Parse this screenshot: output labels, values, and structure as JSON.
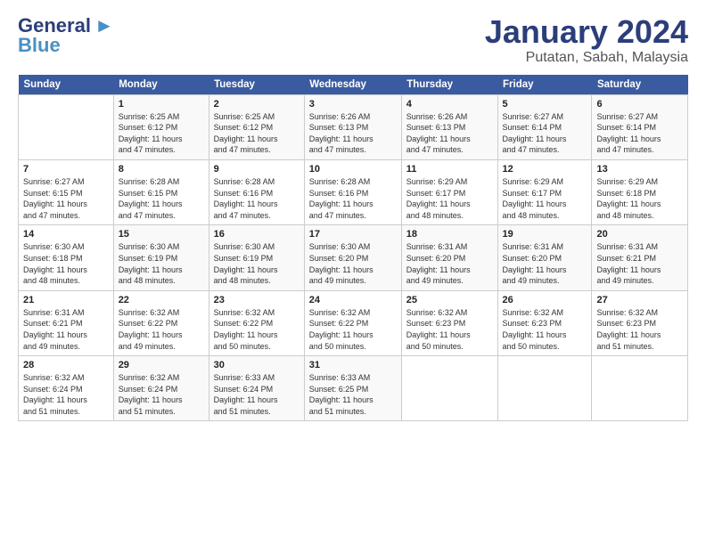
{
  "logo": {
    "line1": "General",
    "line2": "Blue"
  },
  "title": "January 2024",
  "subtitle": "Putatan, Sabah, Malaysia",
  "days_header": [
    "Sunday",
    "Monday",
    "Tuesday",
    "Wednesday",
    "Thursday",
    "Friday",
    "Saturday"
  ],
  "weeks": [
    [
      {
        "num": "",
        "info": ""
      },
      {
        "num": "1",
        "info": "Sunrise: 6:25 AM\nSunset: 6:12 PM\nDaylight: 11 hours\nand 47 minutes."
      },
      {
        "num": "2",
        "info": "Sunrise: 6:25 AM\nSunset: 6:12 PM\nDaylight: 11 hours\nand 47 minutes."
      },
      {
        "num": "3",
        "info": "Sunrise: 6:26 AM\nSunset: 6:13 PM\nDaylight: 11 hours\nand 47 minutes."
      },
      {
        "num": "4",
        "info": "Sunrise: 6:26 AM\nSunset: 6:13 PM\nDaylight: 11 hours\nand 47 minutes."
      },
      {
        "num": "5",
        "info": "Sunrise: 6:27 AM\nSunset: 6:14 PM\nDaylight: 11 hours\nand 47 minutes."
      },
      {
        "num": "6",
        "info": "Sunrise: 6:27 AM\nSunset: 6:14 PM\nDaylight: 11 hours\nand 47 minutes."
      }
    ],
    [
      {
        "num": "7",
        "info": "Sunrise: 6:27 AM\nSunset: 6:15 PM\nDaylight: 11 hours\nand 47 minutes."
      },
      {
        "num": "8",
        "info": "Sunrise: 6:28 AM\nSunset: 6:15 PM\nDaylight: 11 hours\nand 47 minutes."
      },
      {
        "num": "9",
        "info": "Sunrise: 6:28 AM\nSunset: 6:16 PM\nDaylight: 11 hours\nand 47 minutes."
      },
      {
        "num": "10",
        "info": "Sunrise: 6:28 AM\nSunset: 6:16 PM\nDaylight: 11 hours\nand 47 minutes."
      },
      {
        "num": "11",
        "info": "Sunrise: 6:29 AM\nSunset: 6:17 PM\nDaylight: 11 hours\nand 48 minutes."
      },
      {
        "num": "12",
        "info": "Sunrise: 6:29 AM\nSunset: 6:17 PM\nDaylight: 11 hours\nand 48 minutes."
      },
      {
        "num": "13",
        "info": "Sunrise: 6:29 AM\nSunset: 6:18 PM\nDaylight: 11 hours\nand 48 minutes."
      }
    ],
    [
      {
        "num": "14",
        "info": "Sunrise: 6:30 AM\nSunset: 6:18 PM\nDaylight: 11 hours\nand 48 minutes."
      },
      {
        "num": "15",
        "info": "Sunrise: 6:30 AM\nSunset: 6:19 PM\nDaylight: 11 hours\nand 48 minutes."
      },
      {
        "num": "16",
        "info": "Sunrise: 6:30 AM\nSunset: 6:19 PM\nDaylight: 11 hours\nand 48 minutes."
      },
      {
        "num": "17",
        "info": "Sunrise: 6:30 AM\nSunset: 6:20 PM\nDaylight: 11 hours\nand 49 minutes."
      },
      {
        "num": "18",
        "info": "Sunrise: 6:31 AM\nSunset: 6:20 PM\nDaylight: 11 hours\nand 49 minutes."
      },
      {
        "num": "19",
        "info": "Sunrise: 6:31 AM\nSunset: 6:20 PM\nDaylight: 11 hours\nand 49 minutes."
      },
      {
        "num": "20",
        "info": "Sunrise: 6:31 AM\nSunset: 6:21 PM\nDaylight: 11 hours\nand 49 minutes."
      }
    ],
    [
      {
        "num": "21",
        "info": "Sunrise: 6:31 AM\nSunset: 6:21 PM\nDaylight: 11 hours\nand 49 minutes."
      },
      {
        "num": "22",
        "info": "Sunrise: 6:32 AM\nSunset: 6:22 PM\nDaylight: 11 hours\nand 49 minutes."
      },
      {
        "num": "23",
        "info": "Sunrise: 6:32 AM\nSunset: 6:22 PM\nDaylight: 11 hours\nand 50 minutes."
      },
      {
        "num": "24",
        "info": "Sunrise: 6:32 AM\nSunset: 6:22 PM\nDaylight: 11 hours\nand 50 minutes."
      },
      {
        "num": "25",
        "info": "Sunrise: 6:32 AM\nSunset: 6:23 PM\nDaylight: 11 hours\nand 50 minutes."
      },
      {
        "num": "26",
        "info": "Sunrise: 6:32 AM\nSunset: 6:23 PM\nDaylight: 11 hours\nand 50 minutes."
      },
      {
        "num": "27",
        "info": "Sunrise: 6:32 AM\nSunset: 6:23 PM\nDaylight: 11 hours\nand 51 minutes."
      }
    ],
    [
      {
        "num": "28",
        "info": "Sunrise: 6:32 AM\nSunset: 6:24 PM\nDaylight: 11 hours\nand 51 minutes."
      },
      {
        "num": "29",
        "info": "Sunrise: 6:32 AM\nSunset: 6:24 PM\nDaylight: 11 hours\nand 51 minutes."
      },
      {
        "num": "30",
        "info": "Sunrise: 6:33 AM\nSunset: 6:24 PM\nDaylight: 11 hours\nand 51 minutes."
      },
      {
        "num": "31",
        "info": "Sunrise: 6:33 AM\nSunset: 6:25 PM\nDaylight: 11 hours\nand 51 minutes."
      },
      {
        "num": "",
        "info": ""
      },
      {
        "num": "",
        "info": ""
      },
      {
        "num": "",
        "info": ""
      }
    ]
  ]
}
